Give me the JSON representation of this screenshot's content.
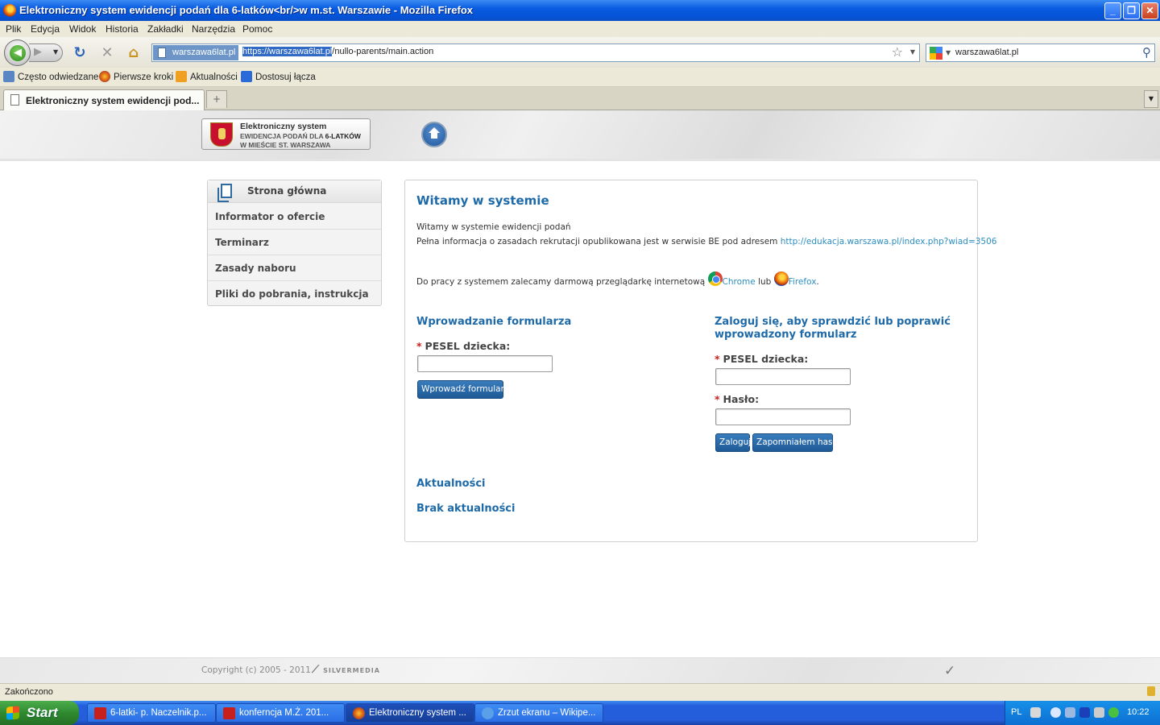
{
  "window": {
    "title": "Elektroniczny system ewidencji podań dla 6-latków<br/>w m.st. Warszawie - Mozilla Firefox"
  },
  "menu": [
    "Plik",
    "Edycja",
    "Widok",
    "Historia",
    "Zakładki",
    "Narzędzia",
    "Pomoc"
  ],
  "navbar": {
    "site": "warszawa6lat.pl",
    "url_selected": "https://warszawa6lat.pl",
    "url_rest": "/nullo-parents/main.action",
    "search": "warszawa6lat.pl"
  },
  "bookmarks": [
    "Często odwiedzane",
    "Pierwsze kroki",
    "Aktualności",
    "Dostosuj łącza"
  ],
  "tab": {
    "title": "Elektroniczny system ewidencji pod...",
    "new_tab": "+"
  },
  "header": {
    "logo_line1": "Elektroniczny system",
    "logo_line2_a": "EWIDENCJA PODAŃ DLA ",
    "logo_line2_b": "6-LATKÓW",
    "logo_line3": "W MIEŚCIE ST. WARSZAWA"
  },
  "sidebar": {
    "head": "Strona główna",
    "items": [
      {
        "label": "Informator o ofercie"
      },
      {
        "label": "Terminarz"
      },
      {
        "label": "Zasady naboru"
      },
      {
        "label": "Pliki do pobrania, instrukcja"
      }
    ]
  },
  "main": {
    "title": "Witamy w systemie",
    "intro1": "Witamy w systemie ewidencji podań",
    "intro2": "Pełna informacja o zasadach rekrutacji opublikowana jest w serwisie BE pod adresem ",
    "intro2_link": "http://edukacja.warszawa.pl/index.php?wiad=3506",
    "browsers_prefix": "Do pracy z systemem zalecamy darmową przeglądarkę internetową ",
    "chrome": "Chrome",
    "browsers_or": " lub ",
    "firefox": "Firefox",
    "browsers_suffix": ".",
    "form_title": "Wprowadzanie formularza",
    "pesel_label": "PESEL dziecka:",
    "required_mark": "*",
    "form_button": "Wprowadź formularz",
    "login_title_1": "Zaloguj się, aby sprawdzić lub poprawić",
    "login_title_2": "wprowadzony formularz",
    "login_pesel_label": "PESEL dziecka:",
    "password_label": "Hasło:",
    "login_button": "Zaloguj",
    "forgot_button": "Zapomniałem hasła",
    "news_title": "Aktualności",
    "news_empty": "Brak aktualności"
  },
  "footer": {
    "copyright": "Copyright (c) 2005 - 2011",
    "brand": "SILVERMEDIA"
  },
  "status": {
    "text": "Zakończono"
  },
  "taskbar": {
    "start": "Start",
    "tasks": [
      {
        "label": "6-latki- p. Naczelnik.p..."
      },
      {
        "label": "konferncja  M.Ż. 201..."
      },
      {
        "label": "Elektroniczny system ..."
      },
      {
        "label": "Zrzut ekranu – Wikipe..."
      }
    ],
    "lang": "PL",
    "clock": "10:22"
  }
}
